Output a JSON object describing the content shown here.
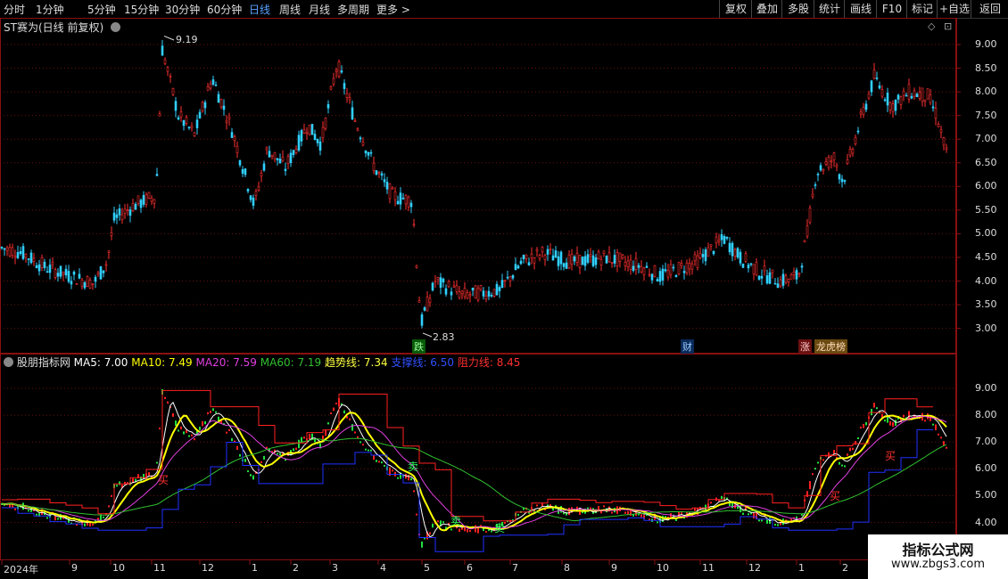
{
  "toolbar": {
    "periods": [
      "分时",
      "1分钟",
      "5分钟",
      "15分钟",
      "30分钟",
      "60分钟",
      "日线",
      "周线",
      "月线",
      "多周期",
      "更多 >"
    ],
    "active_period": "日线",
    "right_buttons": [
      "复权",
      "叠加",
      "多股",
      "统计",
      "画线",
      "F10",
      "标记",
      "+自选",
      "返回"
    ]
  },
  "main_chart": {
    "title": "ST赛为(日线 前复权)",
    "high_label": "9.19",
    "low_label": "2.83",
    "y_ticks": [
      "9.00",
      "8.50",
      "8.00",
      "7.50",
      "7.00",
      "6.50",
      "6.00",
      "5.50",
      "5.00",
      "4.50",
      "4.00",
      "3.50",
      "3.00"
    ],
    "events": [
      "跌",
      "财",
      "涨",
      "龙虎榜"
    ]
  },
  "indicator": {
    "name": "股朋指标网",
    "ma5": "MA5: 7.00",
    "ma10": "MA10: 7.49",
    "ma20": "MA20: 7.59",
    "ma60": "MA60: 7.19",
    "trend": "趋势线: 7.34",
    "support": "支撑线: 6.50",
    "resist": "阻力线: 8.45",
    "y_ticks": [
      "9.00",
      "8.00",
      "7.00",
      "6.00",
      "5.00",
      "4.00"
    ],
    "signals": [
      "卖",
      "卖",
      "卖",
      "买",
      "买",
      "买"
    ]
  },
  "x_axis": [
    "2024年",
    "9",
    "10",
    "11",
    "12",
    "1",
    "2",
    "3",
    "4",
    "5",
    "6",
    "7",
    "8",
    "9",
    "10",
    "11",
    "12",
    "1",
    "2"
  ],
  "colors": {
    "up": "#ff3030",
    "down": "#30d0ff",
    "frame": "#8a1010",
    "ma5": "#ffffff",
    "ma10": "#ffff00",
    "ma20": "#e040e0",
    "ma60": "#30c030",
    "trend": "#ffff40",
    "support": "#2030ff",
    "resist": "#ff2020"
  },
  "watermark": {
    "line1": "指标公式网",
    "line2": "www.zbgs3.com"
  }
}
